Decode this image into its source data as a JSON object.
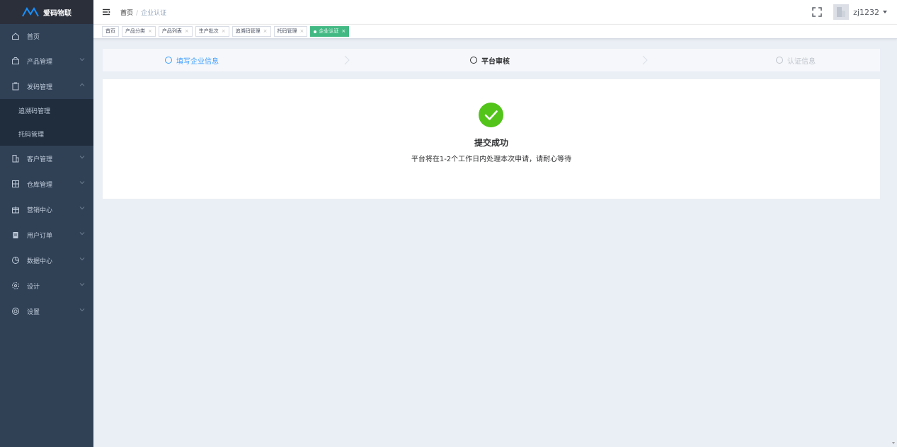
{
  "app": {
    "logo_text": "爱码物联",
    "brand_color": "#1890ff"
  },
  "sidebar": {
    "items": [
      {
        "label": "首页",
        "icon": "home-icon"
      },
      {
        "label": "产品管理",
        "icon": "box-icon"
      },
      {
        "label": "发码管理",
        "icon": "clipboard-icon",
        "expanded": true,
        "children": [
          {
            "label": "追溯码管理"
          },
          {
            "label": "托码管理"
          }
        ]
      },
      {
        "label": "客户管理",
        "icon": "building-icon"
      },
      {
        "label": "仓库管理",
        "icon": "grid-icon"
      },
      {
        "label": "营销中心",
        "icon": "gift-icon"
      },
      {
        "label": "用户订单",
        "icon": "list-icon"
      },
      {
        "label": "数据中心",
        "icon": "pie-icon"
      },
      {
        "label": "设计",
        "icon": "flower-icon"
      },
      {
        "label": "设置",
        "icon": "gear-icon"
      }
    ]
  },
  "header": {
    "breadcrumb": [
      "首页",
      "企业认证"
    ],
    "username": "zj1232"
  },
  "tags": [
    {
      "label": "首页",
      "closable": false,
      "active": false
    },
    {
      "label": "产品分类",
      "closable": true,
      "active": false
    },
    {
      "label": "产品列表",
      "closable": true,
      "active": false
    },
    {
      "label": "生产批次",
      "closable": true,
      "active": false
    },
    {
      "label": "追溯码管理",
      "closable": true,
      "active": false
    },
    {
      "label": "托码管理",
      "closable": true,
      "active": false
    },
    {
      "label": "企业认证",
      "closable": true,
      "active": true
    }
  ],
  "steps": [
    {
      "label": "填写企业信息",
      "state": "done"
    },
    {
      "label": "平台审核",
      "state": "current"
    },
    {
      "label": "认证信息",
      "state": "pending"
    }
  ],
  "result": {
    "title": "提交成功",
    "subtitle": "平台将在1-2个工作日内处理本次申请，请耐心等待",
    "icon": "success-check-icon",
    "color": "#52c41a"
  },
  "tag_close_glyph": "×"
}
